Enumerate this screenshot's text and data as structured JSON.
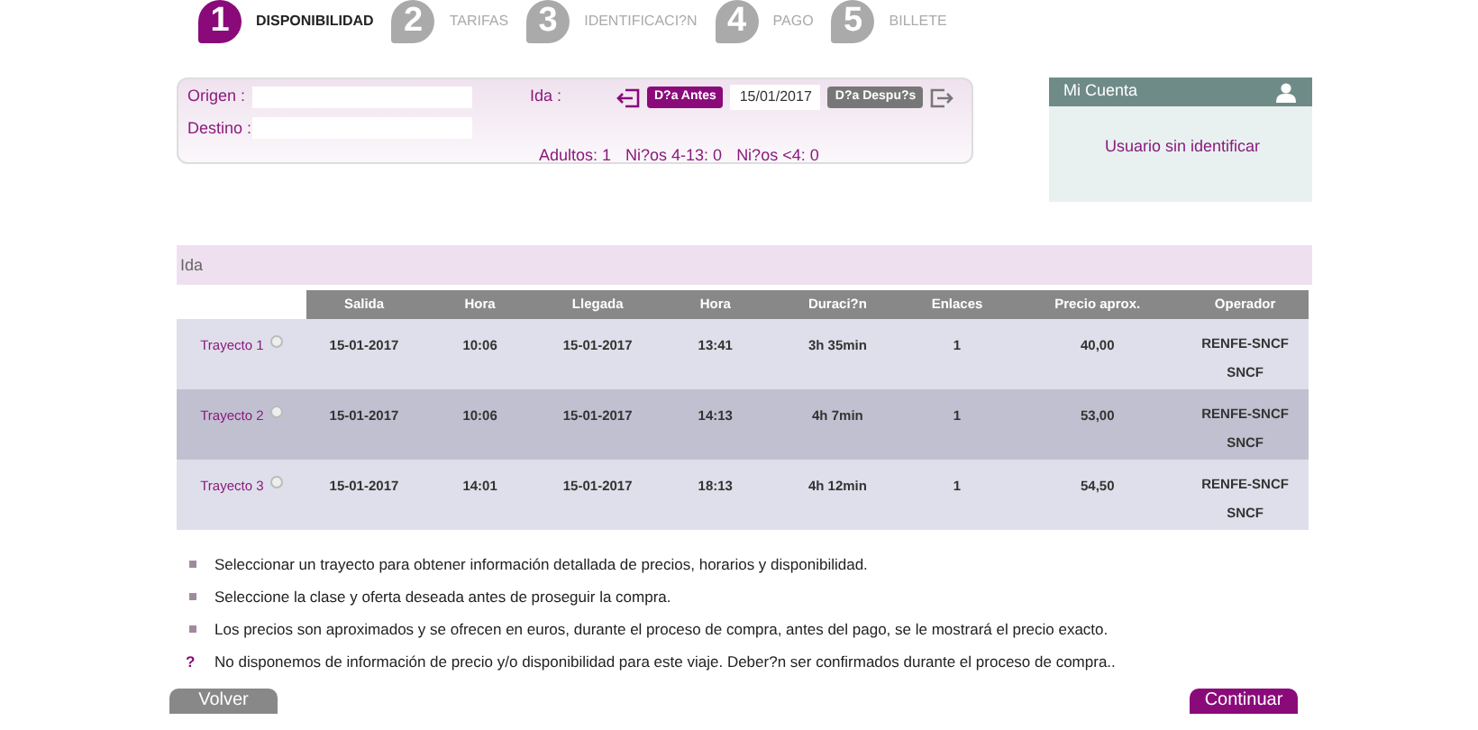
{
  "steps": [
    {
      "number": "1",
      "label": "DISPONIBILIDAD",
      "selected": true
    },
    {
      "number": "2",
      "label": "TARIFAS",
      "selected": false
    },
    {
      "number": "3",
      "label": "IDENTIFICACI?N",
      "selected": false
    },
    {
      "number": "4",
      "label": "PAGO",
      "selected": false
    },
    {
      "number": "5",
      "label": "BILLETE",
      "selected": false
    }
  ],
  "search": {
    "origin_label": "Origen :",
    "destination_label": "Destino :",
    "outbound_label": "Ida :",
    "previous_day": "D?a Antes",
    "date": "15/01/2017",
    "next_day": "D?a Despu?s",
    "passengers": [
      {
        "label": "Adultos:",
        "value": "1"
      },
      {
        "label": "Ni?os 4-13:",
        "value": "0"
      },
      {
        "label": "Ni?os <4:",
        "value": "0"
      }
    ]
  },
  "account": {
    "title": "Mi Cuenta",
    "user": "Usuario sin identificar"
  },
  "section_title": "Ida",
  "table": {
    "columns": [
      "Salida",
      "Hora",
      "Llegada",
      "Hora",
      "Duraci?n",
      "Enlaces",
      "Precio aprox.",
      "Operador"
    ],
    "rows": [
      {
        "label": "Trayecto 1",
        "selected": false,
        "cells": [
          "15-01-2017",
          "10:06",
          "15-01-2017",
          "13:41",
          "3h 35min",
          "1",
          "40,00"
        ],
        "operators": [
          "RENFE-SNCF",
          "SNCF"
        ]
      },
      {
        "label": "Trayecto 2",
        "selected": false,
        "cells": [
          "15-01-2017",
          "10:06",
          "15-01-2017",
          "14:13",
          "4h 7min",
          "1",
          "53,00"
        ],
        "operators": [
          "RENFE-SNCF",
          "SNCF"
        ]
      },
      {
        "label": "Trayecto 3",
        "selected": false,
        "cells": [
          "15-01-2017",
          "14:01",
          "15-01-2017",
          "18:13",
          "4h 12min",
          "1",
          "54,50"
        ],
        "operators": [
          "RENFE-SNCF",
          "SNCF"
        ]
      }
    ]
  },
  "notes": [
    {
      "kind": "bullet",
      "text": "Seleccionar un trayecto para obtener información detallada de precios, horarios y disponibilidad."
    },
    {
      "kind": "bullet",
      "text": "Seleccione la clase y oferta deseada antes de proseguir la compra."
    },
    {
      "kind": "bullet",
      "text": "Los precios son aproximados y se ofrecen en euros, durante el proceso de compra, antes del pago, se le mostrará el precio exacto."
    },
    {
      "kind": "question",
      "marker": "?",
      "text": "No disponemos de información de precio y/o disponibilidad para este viaje. Deber?n ser confirmados durante el proceso de compra.."
    }
  ],
  "buttons": {
    "back": "Volver",
    "continue": "Continuar"
  }
}
